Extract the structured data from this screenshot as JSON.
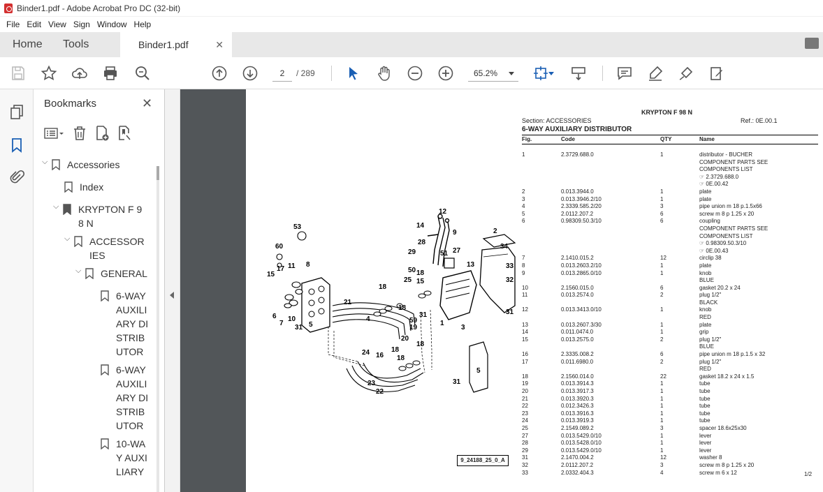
{
  "window": {
    "title": "Binder1.pdf - Adobe Acrobat Pro DC (32-bit)"
  },
  "menu": [
    "File",
    "Edit",
    "View",
    "Sign",
    "Window",
    "Help"
  ],
  "tabs": {
    "home": "Home",
    "tools": "Tools",
    "document": "Binder1.pdf"
  },
  "toolbar": {
    "page_current": "2",
    "page_total": "/ 289",
    "zoom": "65.2%"
  },
  "bookmarks": {
    "title": "Bookmarks",
    "items": [
      {
        "label": "Accessories",
        "level": 0,
        "expanded": true
      },
      {
        "label": "Index",
        "level": 1,
        "expanded": null
      },
      {
        "label": "KRYPTON F 98 N",
        "level": 1,
        "expanded": true
      },
      {
        "label": "ACCESSORIES",
        "level": 2,
        "expanded": true
      },
      {
        "label": "GENERAL",
        "level": 3,
        "expanded": true
      },
      {
        "label": "6-WAY AUXILIARY DISTRIBUTOR",
        "level": 4,
        "expanded": null
      },
      {
        "label": "6-WAY AUXILIARY DISTRIBUTOR",
        "level": 4,
        "expanded": null
      },
      {
        "label": "10-WAY AUXILIARY",
        "level": 4,
        "expanded": null
      }
    ]
  },
  "document": {
    "model": "KRYPTON F 98 N",
    "section": "Section: ACCESSORIES",
    "ref": "Ref.: 0E.00.1",
    "title": "6-WAY AUXILIARY DISTRIBUTOR",
    "columns": {
      "fig": "Fig.",
      "code": "Code",
      "qty": "QTY",
      "name": "Name"
    },
    "rows": [
      [
        "1",
        "2.3729.688.0",
        "1",
        "distributor - BUCHER"
      ],
      [
        "",
        "",
        "",
        "COMPONENT PARTS SEE"
      ],
      [
        "",
        "",
        "",
        "COMPONENTS LIST"
      ],
      [
        "",
        "",
        "",
        "☞ 2.3729.688.0"
      ],
      [
        "",
        "",
        "",
        "☞ 0E.00.42"
      ],
      [
        "2",
        "0.013.3944.0",
        "1",
        "plate"
      ],
      [
        "3",
        "0.013.3946.2/10",
        "1",
        "plate"
      ],
      [
        "4",
        "2.3339.585.2/20",
        "3",
        "pipe union m 18 p.1.5x66"
      ],
      [
        "5",
        "2.0112.207.2",
        "6",
        "screw m 8 p 1.25 x 20"
      ],
      [
        "6",
        "0.98309.50.3/10",
        "6",
        "coupling"
      ],
      [
        "",
        "",
        "",
        "COMPONENT PARTS SEE"
      ],
      [
        "",
        "",
        "",
        "COMPONENTS LIST"
      ],
      [
        "",
        "",
        "",
        "☞ 0.98309.50.3/10"
      ],
      [
        "",
        "",
        "",
        "☞ 0E.00.43"
      ],
      [
        "7",
        "2.1410.015.2",
        "12",
        "circlip 38"
      ],
      [
        "8",
        "0.013.2603.2/10",
        "1",
        "plate"
      ],
      [
        "9",
        "0.013.2865.0/10",
        "1",
        "knob"
      ],
      [
        "",
        "",
        "",
        "BLUE"
      ],
      [
        "10",
        "2.1560.015.0",
        "6",
        "gasket 20.2 x 24"
      ],
      [
        "11",
        "0.013.2574.0",
        "2",
        "plug 1/2\""
      ],
      [
        "",
        "",
        "",
        "BLACK"
      ],
      [
        "12",
        "0.013.3413.0/10",
        "1",
        "knob"
      ],
      [
        "",
        "",
        "",
        "RED"
      ],
      [
        "13",
        "0.013.2607.3/30",
        "1",
        "plate"
      ],
      [
        "14",
        "0.011.0474.0",
        "1",
        "grip"
      ],
      [
        "15",
        "0.013.2575.0",
        "2",
        "plug 1/2\""
      ],
      [
        "",
        "",
        "",
        "BLUE"
      ],
      [
        "16",
        "2.3335.008.2",
        "6",
        "pipe union m 18 p.1.5 x 32"
      ],
      [
        "17",
        "0.011.6980.0",
        "2",
        "plug 1/2\""
      ],
      [
        "",
        "",
        "",
        "RED"
      ],
      [
        "18",
        "2.1560.014.0",
        "22",
        "gasket 18.2 x 24 x 1.5"
      ],
      [
        "19",
        "0.013.3914.3",
        "1",
        "tube"
      ],
      [
        "20",
        "0.013.3917.3",
        "1",
        "tube"
      ],
      [
        "21",
        "0.013.3920.3",
        "1",
        "tube"
      ],
      [
        "22",
        "0.012.3426.3",
        "1",
        "tube"
      ],
      [
        "23",
        "0.013.3916.3",
        "1",
        "tube"
      ],
      [
        "24",
        "0.013.3919.3",
        "1",
        "tube"
      ],
      [
        "25",
        "2.1549.089.2",
        "3",
        "spacer 18.6x25x30"
      ],
      [
        "27",
        "0.013.5429.0/10",
        "1",
        "lever"
      ],
      [
        "28",
        "0.013.5428.0/10",
        "1",
        "lever"
      ],
      [
        "29",
        "0.013.5429.0/10",
        "1",
        "lever"
      ],
      [
        "31",
        "2.1470.004.2",
        "12",
        "washer 8"
      ],
      [
        "32",
        "2.0112.207.2",
        "3",
        "screw m 8 p 1.25 x 20"
      ],
      [
        "33",
        "2.0332.404.3",
        "4",
        "screw m 6 x 12"
      ]
    ],
    "page_indicator": "1/2",
    "diagram_code": "9_24188_25_0_A"
  }
}
